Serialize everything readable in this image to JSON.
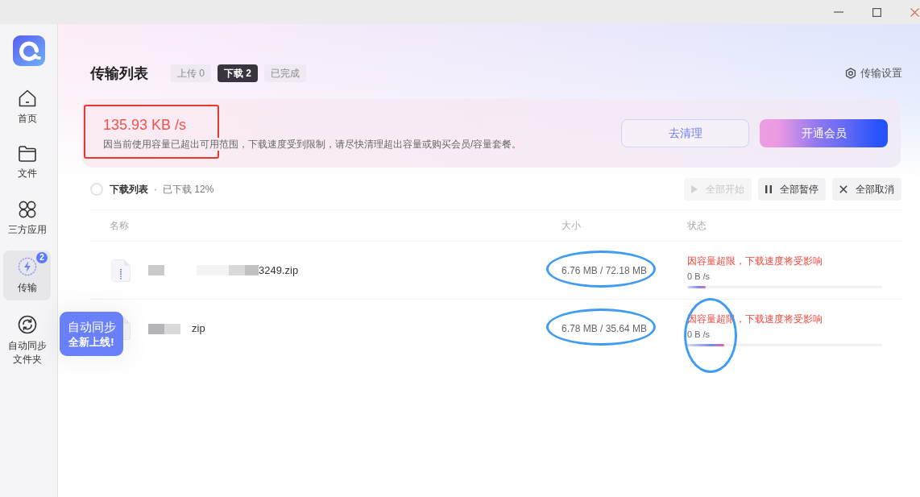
{
  "sidebar": {
    "items": [
      {
        "label": "首页",
        "kind": "home",
        "selected": false
      },
      {
        "label": "文件",
        "kind": "files",
        "selected": false
      },
      {
        "label": "三方应用",
        "kind": "apps",
        "selected": false
      },
      {
        "label": "传输",
        "kind": "transfer",
        "selected": true,
        "badge": "2"
      },
      {
        "label": "自动同步文件夹",
        "kind": "sync",
        "selected": false
      }
    ]
  },
  "tooltip": {
    "title": "自动同步",
    "subtitle": "全新上线!"
  },
  "header": {
    "title": "传输列表",
    "tabs": [
      {
        "label": "上传 0",
        "selected": false
      },
      {
        "label": "下载 2",
        "selected": true
      },
      {
        "label": "已完成",
        "selected": false
      }
    ],
    "settings": "传输设置"
  },
  "notice": {
    "speed": "135.93 KB /s",
    "message": "因当前使用容量已超出可用范围，下载速度受到限制，请尽快清理超出容量或购买会员/容量套餐。",
    "circled": true,
    "buttons": [
      {
        "label": "去清理",
        "kind": "outline"
      },
      {
        "label": "开通会员",
        "kind": "gradient"
      }
    ]
  },
  "toolbar": {
    "checked": false,
    "title": "下载列表",
    "separator": "·",
    "progress": "已下载 12%",
    "buttons": [
      {
        "label": "全部开始",
        "kind": "start",
        "disabled": true
      },
      {
        "label": "全部暂停",
        "kind": "pause",
        "disabled": false
      },
      {
        "label": "全部取消",
        "kind": "cancel",
        "disabled": false
      }
    ]
  },
  "table": {
    "columns": [
      "名称",
      "大小",
      "状态"
    ],
    "rows": [
      {
        "name": "3249.zip",
        "redacted": true,
        "size": "6.76 MB / 72.18 MB",
        "size_circled": true,
        "status": "因容量超限，下载速度将受影响",
        "speed": "0 B /s",
        "level": 0.095,
        "status_circled": false
      },
      {
        "name": "zip",
        "redacted": true,
        "size": "6.78 MB / 35.64 MB",
        "size_circled": true,
        "status": "因容量超限，下载速度将受影响",
        "speed": "0 B /s",
        "level": 0.19,
        "status_circled": true
      }
    ]
  }
}
